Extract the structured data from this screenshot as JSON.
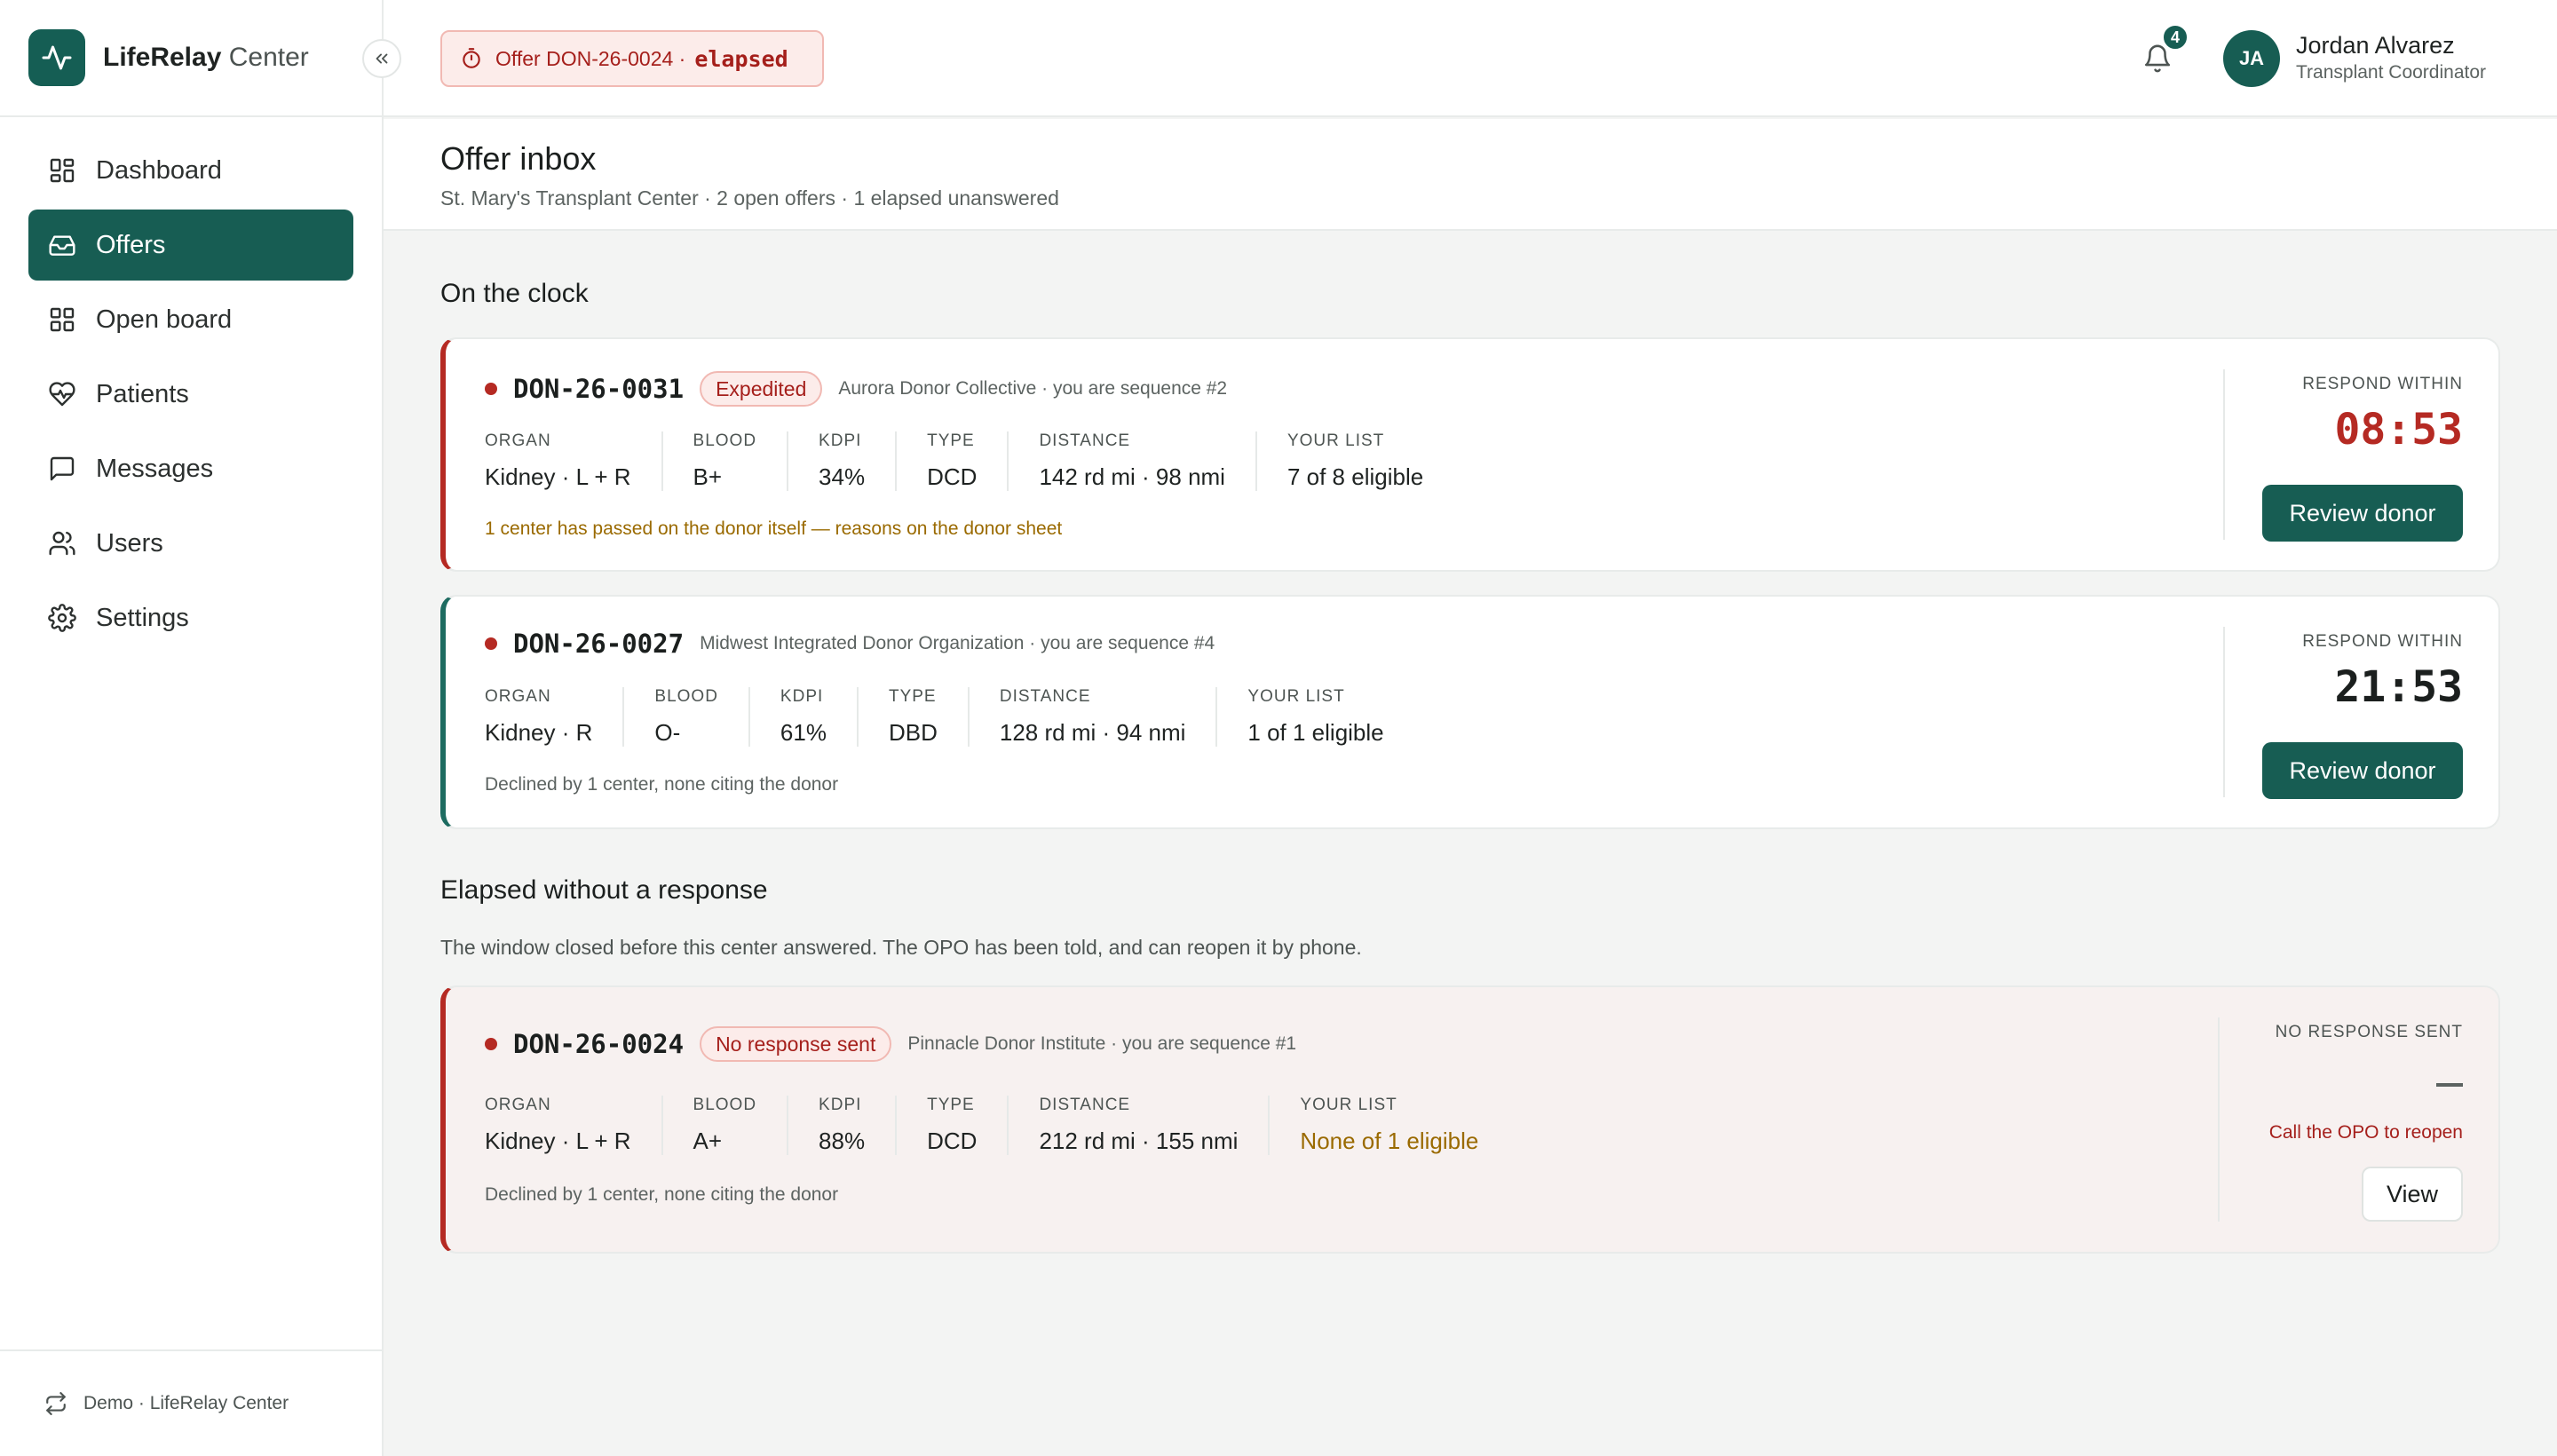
{
  "brand": {
    "name_bold": "LifeRelay",
    "name_rest": "Center"
  },
  "sidebar": {
    "items": [
      {
        "label": "Dashboard",
        "icon": "grid-icon"
      },
      {
        "label": "Offers",
        "icon": "inbox-icon",
        "active": true
      },
      {
        "label": "Open board",
        "icon": "board-icon"
      },
      {
        "label": "Patients",
        "icon": "heart-pulse-icon"
      },
      {
        "label": "Messages",
        "icon": "message-icon"
      },
      {
        "label": "Users",
        "icon": "users-icon"
      },
      {
        "label": "Settings",
        "icon": "gear-icon"
      }
    ],
    "footer": {
      "prefix": "Demo · ",
      "name": "LifeRelay Center"
    }
  },
  "topbar": {
    "alert": {
      "text": "Offer DON-26-0024 ·",
      "status": "elapsed"
    },
    "notifications": 4,
    "notifications_label": "4",
    "user": {
      "initials": "JA",
      "name": "Jordan Alvarez",
      "role": "Transplant Coordinator"
    }
  },
  "page": {
    "title": "Offer inbox",
    "subtitle": "St. Mary's Transplant Center · 2 open offers · 1 elapsed unanswered"
  },
  "sections": {
    "on_clock": "On the clock",
    "elapsed": "Elapsed without a response",
    "elapsed_desc": "The window closed before this center answered. The OPO has been told, and can reopen it by phone."
  },
  "labels": {
    "organ": "ORGAN",
    "blood": "BLOOD",
    "kdpi": "KDPI",
    "type": "TYPE",
    "distance": "DISTANCE",
    "your_list": "YOUR LIST",
    "respond_within": "RESPOND WITHIN",
    "no_response_sent": "NO RESPONSE SENT",
    "review_donor": "Review donor",
    "view": "View",
    "call_opo": "Call the OPO to reopen"
  },
  "offers": [
    {
      "id": "DON-26-0031",
      "pill": "Expedited",
      "meta": "Aurora Donor Collective · you are sequence #2",
      "organ": "Kidney · L + R",
      "blood": "B+",
      "kdpi": "34%",
      "type": "DCD",
      "distance": "142 rd mi · 98 nmi",
      "your_list": "7 of 8 eligible",
      "note": "1 center has passed on the donor itself — reasons on the donor sheet",
      "timer": "08:53"
    },
    {
      "id": "DON-26-0027",
      "meta": "Midwest Integrated Donor Organization · you are sequence #4",
      "organ": "Kidney · R",
      "blood": "O-",
      "kdpi": "61%",
      "type": "DBD",
      "distance": "128 rd mi · 94 nmi",
      "your_list": "1 of 1 eligible",
      "note": "Declined by 1 center, none citing the donor",
      "timer": "21:53"
    },
    {
      "id": "DON-26-0024",
      "pill": "No response sent",
      "meta": "Pinnacle Donor Institute · you are sequence #1",
      "organ": "Kidney · L + R",
      "blood": "A+",
      "kdpi": "88%",
      "type": "DCD",
      "distance": "212 rd mi · 155 nmi",
      "your_list": "None of 1 eligible",
      "note": "Declined by 1 center, none citing the donor",
      "timer": "—"
    }
  ],
  "colors": {
    "brand": "#175d53",
    "danger": "#b52a23",
    "warning": "#9a6a00"
  }
}
